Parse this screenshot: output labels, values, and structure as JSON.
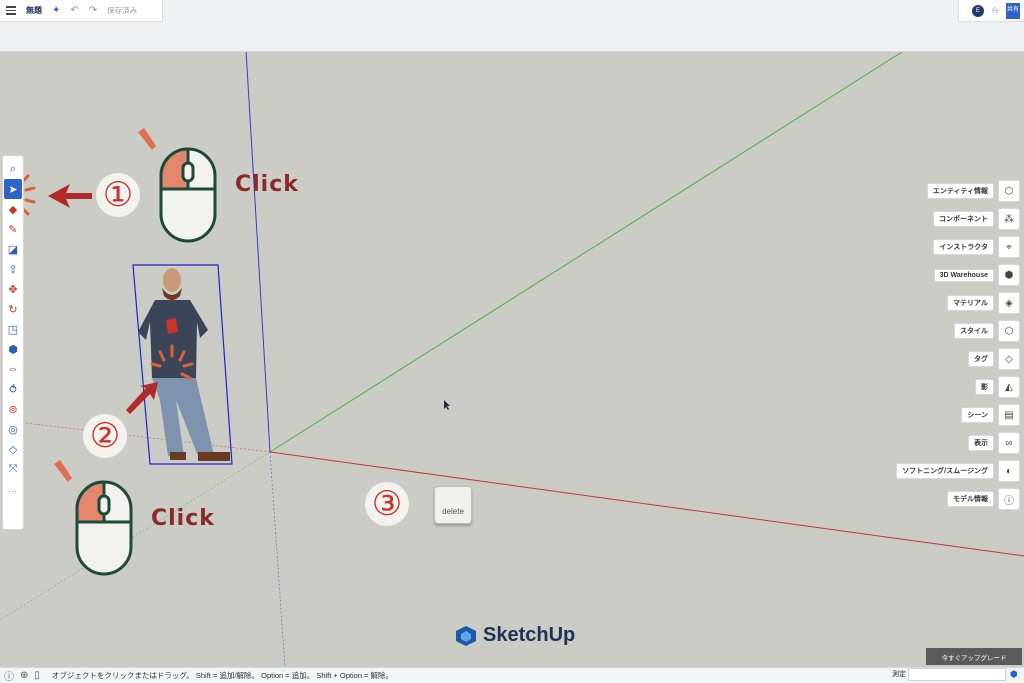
{
  "app": {
    "title": "無題",
    "saved_status": "保存済み"
  },
  "header": {
    "user_initial": "E",
    "share_label": "共有"
  },
  "tools": [
    {
      "name": "search",
      "icon": "search-icon"
    },
    {
      "name": "select",
      "icon": "arrow-cursor-icon",
      "active": true
    },
    {
      "name": "eraser",
      "icon": "eraser-icon"
    },
    {
      "name": "pencil",
      "icon": "pencil-icon"
    },
    {
      "name": "rectangle",
      "icon": "rectangle-icon"
    },
    {
      "name": "push-pull",
      "icon": "push-pull-icon"
    },
    {
      "name": "move",
      "icon": "move-icon"
    },
    {
      "name": "rotate",
      "icon": "rotate-icon"
    },
    {
      "name": "scale",
      "icon": "scale-icon"
    },
    {
      "name": "paint",
      "icon": "paint-bucket-icon"
    },
    {
      "name": "offset",
      "icon": "offset-icon"
    },
    {
      "name": "follow-me",
      "icon": "follow-me-icon"
    },
    {
      "name": "tape",
      "icon": "tape-measure-icon"
    },
    {
      "name": "orbit",
      "icon": "orbit-icon"
    },
    {
      "name": "tag",
      "icon": "tag-icon"
    },
    {
      "name": "axes",
      "icon": "axes-icon"
    },
    {
      "name": "more",
      "icon": "more-icon"
    }
  ],
  "right_panel": [
    {
      "label": "エンティティ情報",
      "icon": "entity-info-icon"
    },
    {
      "label": "コンポーネント",
      "icon": "components-icon"
    },
    {
      "label": "インストラクタ",
      "icon": "instructor-icon"
    },
    {
      "label": "3D Warehouse",
      "icon": "warehouse-icon"
    },
    {
      "label": "マテリアル",
      "icon": "materials-icon"
    },
    {
      "label": "スタイル",
      "icon": "styles-icon"
    },
    {
      "label": "タグ",
      "icon": "tags-icon"
    },
    {
      "label": "影",
      "icon": "shadows-icon"
    },
    {
      "label": "シーン",
      "icon": "scenes-icon"
    },
    {
      "label": "表示",
      "icon": "display-icon"
    },
    {
      "label": "ソフトニング/スムージング",
      "icon": "soften-icon"
    },
    {
      "label": "モデル情報",
      "icon": "model-info-icon"
    }
  ],
  "annotations": {
    "click_label_1": "Click",
    "click_label_2": "Click",
    "step_1": "①",
    "step_2": "②",
    "step_3": "③",
    "delete_key": "delete"
  },
  "brand": {
    "name": "SketchUp"
  },
  "upgrade_label": "今すぐアップグレード",
  "status": {
    "hint": "オブジェクトをクリックまたはドラッグ。 Shift = 追加/解除。 Option = 追加。 Shift + Option = 解除。",
    "measure_label": "測定",
    "measure_value": ""
  },
  "colors": {
    "accent": "#2e64c8",
    "annotation_red": "#c7342b",
    "axis_blue": "#3a3ad0",
    "axis_green": "#4bb04b",
    "axis_red": "#c23a3a",
    "canvas": "#ccccc6"
  }
}
